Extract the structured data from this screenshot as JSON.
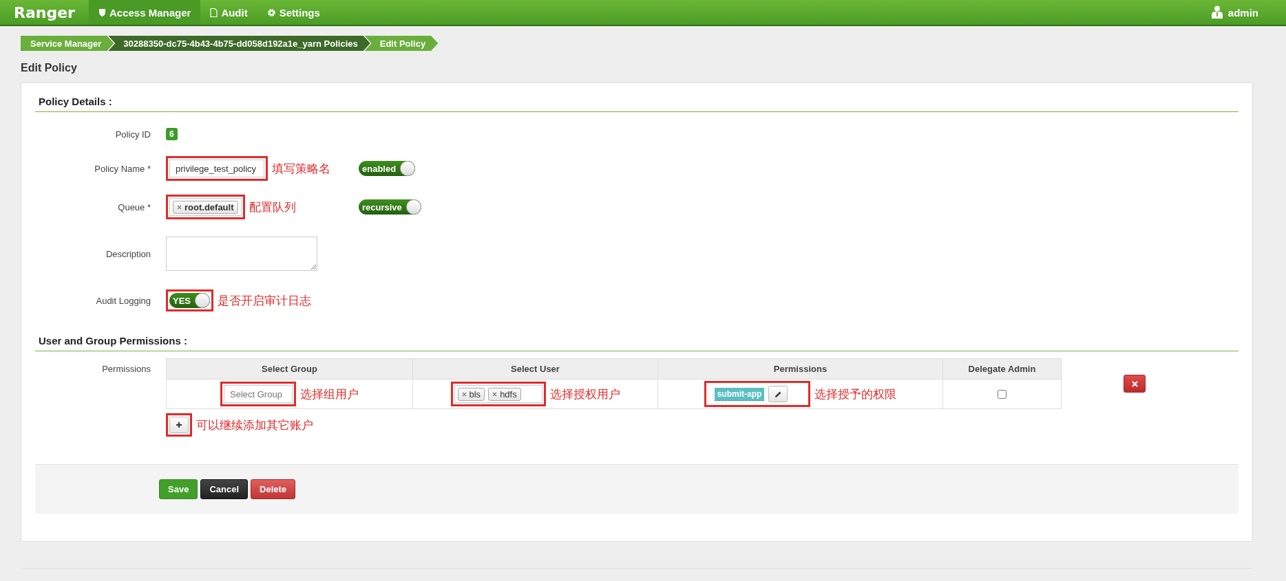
{
  "nav": {
    "brand": "Ranger",
    "items": [
      {
        "label": "Access Manager",
        "selected": true
      },
      {
        "label": "Audit",
        "selected": false
      },
      {
        "label": "Settings",
        "selected": false
      }
    ],
    "user": "admin"
  },
  "breadcrumb": [
    {
      "label": "Service Manager"
    },
    {
      "label": "30288350-dc75-4b43-4b75-dd058d192a1e_yarn Policies"
    },
    {
      "label": "Edit Policy"
    }
  ],
  "page_title": "Edit Policy",
  "policy_details": {
    "heading": "Policy Details :",
    "fields": [
      {
        "kind": "badge",
        "label": "Policy ID",
        "value": "6"
      },
      {
        "kind": "text",
        "label": "Policy Name *",
        "value": "privilege_test_policy",
        "note": "填写策略名",
        "toggle": {
          "label": "enabled",
          "on": true
        }
      },
      {
        "kind": "tags",
        "label": "Queue *",
        "tags": [
          "root.default"
        ],
        "note": "配置队列",
        "toggle": {
          "label": "recursive",
          "on": true
        }
      },
      {
        "kind": "textarea",
        "label": "Description"
      },
      {
        "kind": "switch",
        "label": "Audit Logging",
        "toggle": {
          "label": "YES",
          "on": true
        },
        "note": "是否开启审计日志"
      }
    ]
  },
  "permissions": {
    "heading": "User and Group Permissions :",
    "label": "Permissions",
    "columns": [
      "Select Group",
      "Select User",
      "Permissions",
      "Delegate Admin"
    ],
    "rows": [
      {
        "group_placeholder": "Select Group",
        "group_note": "选择组用户",
        "users": [
          "bls",
          "hdfs"
        ],
        "users_note": "选择授权用户",
        "permissions": [
          "submit-app"
        ],
        "permissions_note": "选择授予的权限",
        "delegate_admin": false
      }
    ],
    "add_note": "可以继续添加其它账户"
  },
  "buttons": [
    {
      "label": "Save",
      "kind": "success"
    },
    {
      "label": "Cancel",
      "kind": "dark"
    },
    {
      "label": "Delete",
      "kind": "danger"
    }
  ]
}
